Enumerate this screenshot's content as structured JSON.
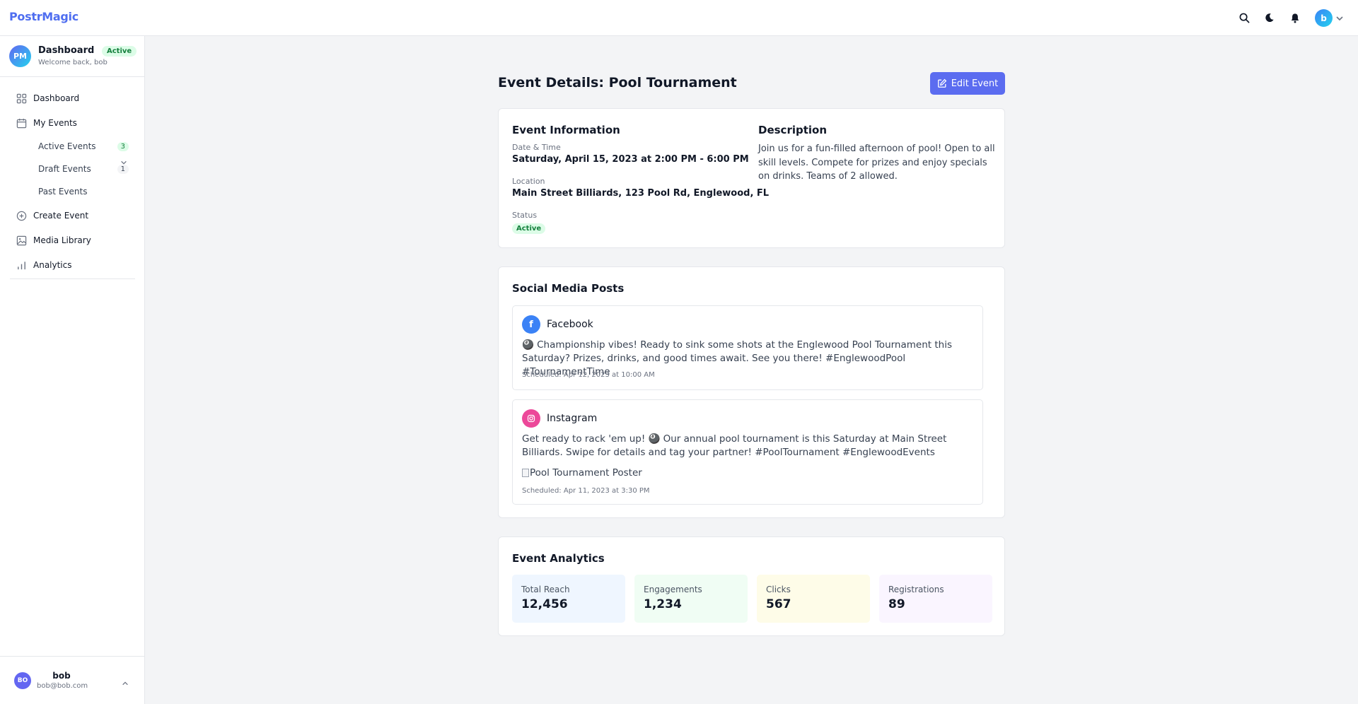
{
  "app": {
    "logo": "PostrMagic"
  },
  "topbar": {
    "avatar_letter": "b"
  },
  "sidebar": {
    "header": {
      "avatar_initials": "PM",
      "title": "Dashboard",
      "badge": "Active",
      "subtitle": "Welcome back, bob"
    },
    "nav": {
      "dashboard": "Dashboard",
      "my_events": "My Events",
      "active_events": "Active Events",
      "active_count": "3",
      "draft_events": "Draft Events",
      "draft_count": "1",
      "past_events": "Past Events",
      "create_event": "Create Event",
      "media_library": "Media Library",
      "analytics": "Analytics"
    },
    "user": {
      "initials": "BO",
      "name": "bob",
      "email": "bob@bob.com"
    }
  },
  "page": {
    "title": "Event Details: Pool Tournament",
    "edit_label": "Edit Event"
  },
  "event_info": {
    "heading": "Event Information",
    "datetime_label": "Date & Time",
    "datetime_value": "Saturday, April 15, 2023 at 2:00 PM - 6:00 PM",
    "location_label": "Location",
    "location_value": "Main Street Billiards, 123 Pool Rd, Englewood, FL",
    "status_label": "Status",
    "status_value": "Active",
    "description_heading": "Description",
    "description": "Join us for a fun-filled afternoon of pool! Open to all skill levels. Compete for prizes and enjoy specials on drinks. Teams of 2 allowed."
  },
  "social": {
    "heading": "Social Media Posts",
    "posts": [
      {
        "platform": "Facebook",
        "icon": "f",
        "text": "🎱 Championship vibes! Ready to sink some shots at the Englewood Pool Tournament this Saturday? Prizes, drinks, and good times await. See you there! #EnglewoodPool #TournamentTime",
        "scheduled": "Scheduled: Apr 12, 2023 at 10:00 AM",
        "color": "#3b82f6"
      },
      {
        "platform": "Instagram",
        "icon": "instagram-icon",
        "text": "Get ready to rack 'em up! 🎱 Our annual pool tournament is this Saturday at Main Street Billiards. Swipe for details and tag your partner! #PoolTournament #EnglewoodEvents",
        "image_alt": "Pool Tournament Poster",
        "scheduled": "Scheduled: Apr 11, 2023 at 3:30 PM",
        "color": "#ec4899"
      }
    ]
  },
  "analytics": {
    "heading": "Event Analytics",
    "stats": [
      {
        "label": "Total Reach",
        "value": "12,456",
        "bg": "#eff6ff"
      },
      {
        "label": "Engagements",
        "value": "1,234",
        "bg": "#f0fdf4"
      },
      {
        "label": "Clicks",
        "value": "567",
        "bg": "#fefce8"
      },
      {
        "label": "Registrations",
        "value": "89",
        "bg": "#faf5ff"
      }
    ]
  }
}
